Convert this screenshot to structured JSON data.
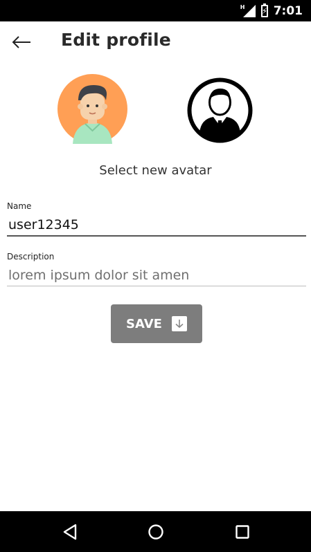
{
  "status_bar": {
    "time": "7:01",
    "network_label": "H",
    "icons": [
      "signal-icon",
      "battery-charging-icon"
    ]
  },
  "header": {
    "title": "Edit profile",
    "back_icon": "arrow-left-icon"
  },
  "avatars": {
    "options": [
      {
        "name": "cartoon-man-avatar",
        "bg_color": "#FF9F55",
        "shirt_color": "#A8E6C0"
      },
      {
        "name": "businessman-avatar",
        "bg_color": "#FFFFFF",
        "ring_color": "#000000"
      }
    ],
    "select_label": "Select new avatar"
  },
  "form": {
    "name_label": "Name",
    "name_value": "user12345",
    "description_label": "Description",
    "description_placeholder": "lorem ipsum dolor sit amen"
  },
  "actions": {
    "save_label": "SAVE",
    "save_icon": "download-icon",
    "save_color": "#7D7D7D"
  },
  "nav_bar": {
    "icons": [
      "nav-back-icon",
      "nav-home-icon",
      "nav-recents-icon"
    ]
  }
}
